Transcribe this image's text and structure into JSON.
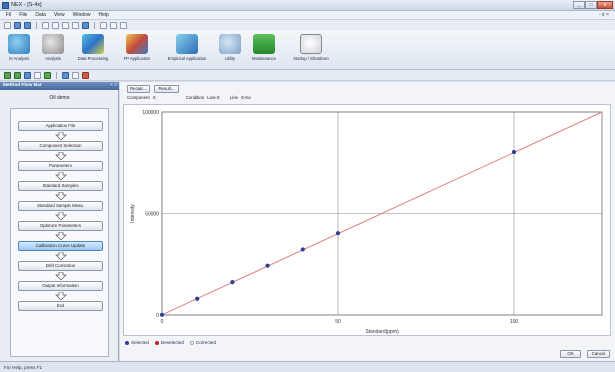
{
  "window": {
    "title": "NEX - [S-4x]",
    "btn_min": "_",
    "btn_max": "□",
    "btn_close": "x"
  },
  "menu": {
    "items": [
      "Fil",
      "File",
      "Data",
      "View",
      "Window",
      "Help"
    ],
    "right_text": "- ♯ ×"
  },
  "ribbon": {
    "items": [
      {
        "label": "XI Analysis",
        "icon": "xi-analysis-icon"
      },
      {
        "label": "Analysis",
        "icon": "analysis-icon"
      },
      {
        "label": "Data Processing",
        "icon": "data-processing-icon"
      },
      {
        "label": "FP Application",
        "icon": "fp-application-icon"
      },
      {
        "label": "Empirical Application",
        "icon": "empirical-application-icon"
      },
      {
        "label": "Utility",
        "icon": "utility-icon"
      },
      {
        "label": "Maintenance",
        "icon": "maintenance-icon"
      },
      {
        "label": "Startup / Shutdown",
        "icon": "startup-shutdown-icon"
      }
    ]
  },
  "flow": {
    "header": "Method Flow Bar",
    "close": "× ×",
    "group_label": "Oil demo",
    "steps": [
      "Application File",
      "Component Selection",
      "Parameters",
      "Standard Samples",
      "Standard Sample Meas.",
      "Optimize Parameters",
      "Calibration Curve Update",
      "Drift Correction",
      "Output Information",
      "Exit"
    ],
    "active_index": 6
  },
  "main": {
    "recalc_label": "Recalc...",
    "result_label": "Result...",
    "component_label": "Component",
    "component_value": "S",
    "condition_label": "Condition",
    "condition_value": "Low-S",
    "line_label": "Line",
    "line_value": "S-Ka"
  },
  "legend": {
    "selected": "Selected",
    "deselected": "Deselected",
    "corrected": "Corrected",
    "colors": {
      "selected": "#2f3f93",
      "deselected": "#b3262f",
      "corrected": "#9aa2b5"
    }
  },
  "buttons": {
    "ok": "OK",
    "cancel": "Cancel"
  },
  "status": {
    "text": "For Help, press F1"
  },
  "chart_data": {
    "type": "scatter",
    "xlabel": "Standard(ppm)",
    "ylabel": "Intensity",
    "xlim": [
      0,
      125
    ],
    "ylim": [
      0,
      100000
    ],
    "xticks": [
      0,
      50,
      100
    ],
    "yticks": [
      0,
      50000,
      100000
    ],
    "xtick_labels": [
      "0",
      "50",
      "100"
    ],
    "ytick_labels": [
      "0",
      "50000",
      "100000"
    ],
    "grid": true,
    "points_x": [
      0,
      10,
      20,
      30,
      40,
      50,
      100
    ],
    "points_y": [
      100,
      8000,
      16200,
      24300,
      32300,
      40300,
      80300
    ],
    "fit_line": {
      "x": [
        0,
        125
      ],
      "y": [
        100,
        100000
      ],
      "color": "#e08080"
    },
    "point_color": "#2f3f93"
  }
}
